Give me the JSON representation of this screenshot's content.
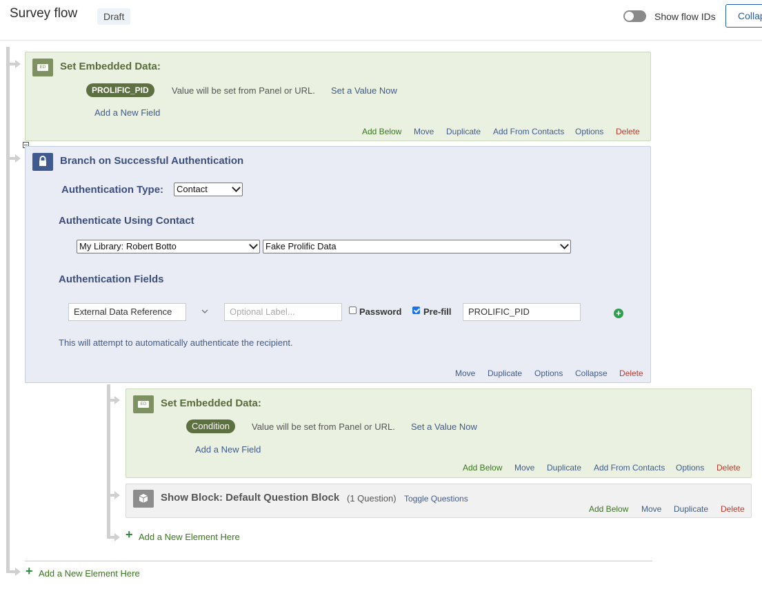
{
  "header": {
    "title": "Survey flow",
    "status_badge": "Draft",
    "show_flow_ids_label": "Show flow IDs",
    "show_flow_ids_on": false,
    "collapse_button": "Collapse"
  },
  "ed_icon_text": "ED",
  "embedded1": {
    "title": "Set Embedded Data:",
    "field_pill": "PROLIFIC_PID",
    "value_text": "Value will be set from Panel or URL.",
    "set_value_link": "Set a Value Now",
    "add_field_link": "Add a New Field",
    "actions": {
      "add_below": "Add Below",
      "move": "Move",
      "duplicate": "Duplicate",
      "add_from_contacts": "Add From Contacts",
      "options": "Options",
      "delete": "Delete"
    }
  },
  "auth": {
    "title": "Branch on Successful Authentication",
    "type_label": "Authentication Type:",
    "type_value": "Contact",
    "using_heading": "Authenticate Using Contact",
    "library_value": "My Library: Robert Botto",
    "list_value": "Fake Prolific Data",
    "fields_heading": "Authentication Fields",
    "field_type_value": "External Data Reference",
    "optional_label_placeholder": "Optional Label...",
    "password_label": "Password",
    "password_checked": false,
    "prefill_label": "Pre-fill",
    "prefill_checked": true,
    "prefill_value": "PROLIFIC_PID",
    "note": "This will attempt to automatically authenticate the recipient.",
    "actions": {
      "move": "Move",
      "duplicate": "Duplicate",
      "options": "Options",
      "collapse": "Collapse",
      "delete": "Delete"
    }
  },
  "embedded2": {
    "title": "Set Embedded Data:",
    "field_pill": "Condition",
    "value_text": "Value will be set from Panel or URL.",
    "set_value_link": "Set a Value Now",
    "add_field_link": "Add a New Field",
    "actions": {
      "add_below": "Add Below",
      "move": "Move",
      "duplicate": "Duplicate",
      "add_from_contacts": "Add From Contacts",
      "options": "Options",
      "delete": "Delete"
    }
  },
  "block": {
    "title": "Show Block: Default Question Block",
    "count": "(1 Question)",
    "toggle_link": "Toggle Questions",
    "actions": {
      "add_below": "Add Below",
      "move": "Move",
      "duplicate": "Duplicate",
      "delete": "Delete"
    }
  },
  "add_element_inner": "Add a New Element Here",
  "add_element_outer": "Add a New Element Here",
  "colors": {
    "green_panel": "#eaf1e1",
    "blue_panel": "#e9ecf5",
    "gray_panel": "#f1f1f1",
    "pill": "#5d7040",
    "delete": "#c0392b",
    "add": "#38761d",
    "link": "#3f5b8c",
    "primary": "#1f5db8"
  }
}
